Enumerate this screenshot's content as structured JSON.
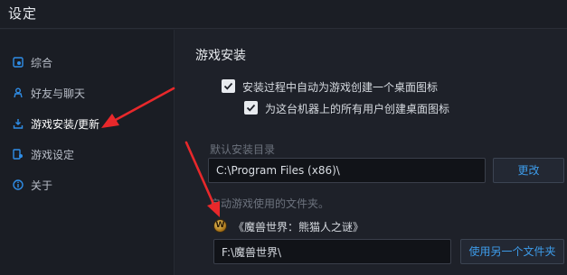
{
  "window": {
    "title": "设定"
  },
  "sidebar": {
    "items": [
      {
        "label": "综合",
        "icon": "general-icon"
      },
      {
        "label": "好友与聊天",
        "icon": "friends-icon"
      },
      {
        "label": "游戏安装/更新",
        "icon": "install-icon",
        "active": true
      },
      {
        "label": "游戏设定",
        "icon": "game-settings-icon"
      },
      {
        "label": "关于",
        "icon": "info-icon"
      }
    ]
  },
  "install": {
    "section_title": "游戏安装",
    "checkbox_desktop_icon": {
      "label": "安装过程中自动为游戏创建一个桌面图标",
      "checked": true
    },
    "checkbox_all_users": {
      "label": "为这台机器上的所有用户创建桌面图标",
      "checked": true
    },
    "default_dir_label": "默认安装目录",
    "default_dir_value": "C:\\Program Files (x86)\\",
    "change_button": "更改",
    "game_folder_hint": "启动游戏使用的文件夹。",
    "game_name": "《魔兽世界：熊猫人之谜》",
    "game_dir_value": "F:\\魔兽世界\\",
    "other_folder_button": "使用另一个文件夹"
  },
  "colors": {
    "background": "#1e2129",
    "sidebar": "#1a1d24",
    "accent_blue": "#2f8ee8",
    "annotation_red": "#e8282b"
  }
}
